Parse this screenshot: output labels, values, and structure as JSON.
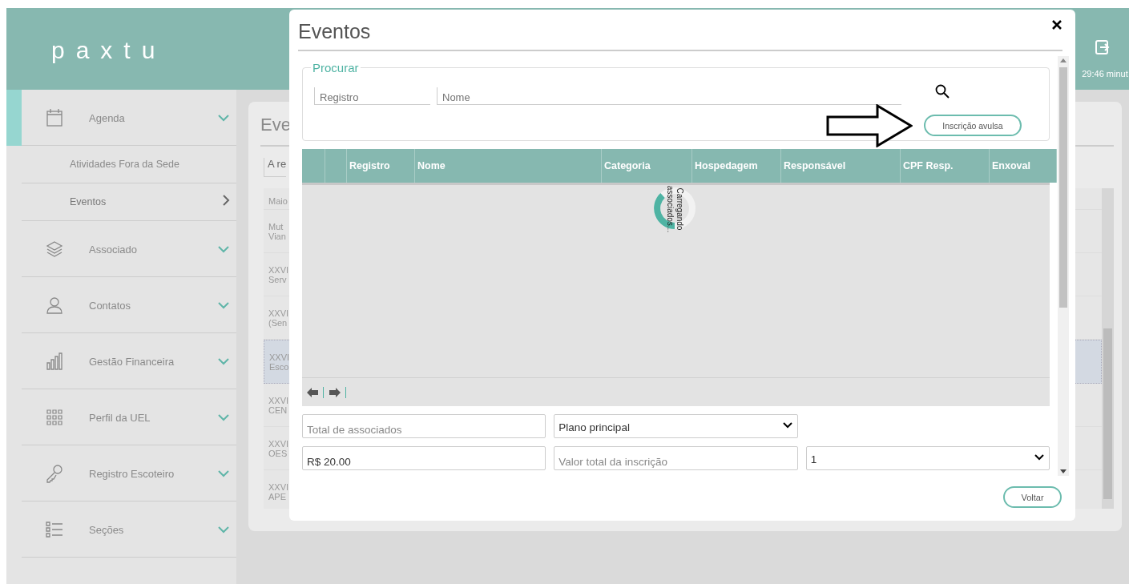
{
  "header": {
    "logo": "paxtu",
    "session_timer": "29:46 minut"
  },
  "sidebar": {
    "items": [
      {
        "label": "Agenda",
        "selected": true,
        "children": [
          {
            "label": "Atividades Fora da Sede",
            "selected": false
          },
          {
            "label": "Eventos",
            "selected": true
          }
        ]
      },
      {
        "label": "Associado",
        "selected": false
      },
      {
        "label": "Contatos",
        "selected": false
      },
      {
        "label": "Gestão Financeira",
        "selected": false
      },
      {
        "label": "Perfil da UEL",
        "selected": false
      },
      {
        "label": "Registro Escoteiro",
        "selected": false
      },
      {
        "label": "Seções",
        "selected": false
      }
    ]
  },
  "background_panel": {
    "title": "Eve",
    "filter_value": "A re",
    "rows": [
      {
        "lines": [
          "Maio"
        ],
        "selected": false
      },
      {
        "lines": [
          "Mut",
          "Vian"
        ],
        "selected": false
      },
      {
        "lines": [
          "XXVI",
          "Serv"
        ],
        "selected": false
      },
      {
        "lines": [
          "XXVI",
          "(Sen"
        ],
        "selected": false
      },
      {
        "lines": [
          "XXVI",
          "Esco"
        ],
        "selected": true
      },
      {
        "lines": [
          "XXVI",
          "CEN"
        ],
        "selected": false
      },
      {
        "lines": [
          "XXVI",
          "OES"
        ],
        "selected": false
      },
      {
        "lines": [
          "XXVI",
          "APE"
        ],
        "selected": false
      }
    ]
  },
  "modal": {
    "title": "Eventos",
    "search": {
      "legend": "Procurar",
      "fields": [
        {
          "placeholder": "Registro"
        },
        {
          "placeholder": "Nome"
        }
      ],
      "button": "Inscrição avulsa"
    },
    "table": {
      "columns": [
        "Registro",
        "Nome",
        "Categoria",
        "Hospedagem",
        "Responsável",
        "CPF Resp.",
        "Enxoval"
      ],
      "loading_text": "Carregando associados..."
    },
    "form_rows": [
      [
        {
          "kind": "input",
          "placeholder": "Total de associados"
        },
        {
          "kind": "select",
          "value": "Plano principal"
        }
      ],
      [
        {
          "kind": "input",
          "value": "R$ 20.00"
        },
        {
          "kind": "input",
          "placeholder": "Valor total da inscrição"
        },
        {
          "kind": "select",
          "value": "1"
        }
      ]
    ],
    "footer_button": "Voltar"
  }
}
